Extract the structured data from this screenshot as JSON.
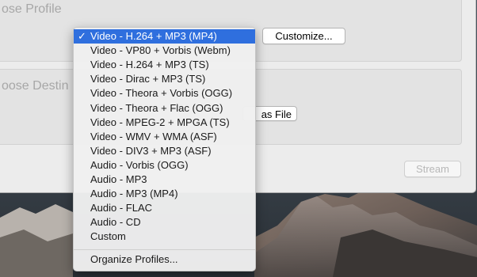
{
  "profile_section": {
    "title": "ose Profile",
    "customize_label": "Customize..."
  },
  "destination_section": {
    "title": "oose Destin",
    "save_file_label": "as File"
  },
  "footer": {
    "stream_label": "Stream"
  },
  "menu": {
    "selected_index": 0,
    "check_mark": "✓",
    "items": [
      "Video - H.264 + MP3 (MP4)",
      "Video - VP80 + Vorbis (Webm)",
      "Video - H.264 + MP3 (TS)",
      "Video - Dirac + MP3 (TS)",
      "Video - Theora + Vorbis (OGG)",
      "Video - Theora + Flac (OGG)",
      "Video - MPEG-2 + MPGA (TS)",
      "Video - WMV + WMA (ASF)",
      "Video - DIV3 + MP3 (ASF)",
      "Audio - Vorbis (OGG)",
      "Audio - MP3",
      "Audio - MP3 (MP4)",
      "Audio - FLAC",
      "Audio - CD",
      "Custom"
    ],
    "organize_label": "Organize Profiles..."
  },
  "colors": {
    "selection": "#2f6fde",
    "window_bg": "#ececec"
  }
}
